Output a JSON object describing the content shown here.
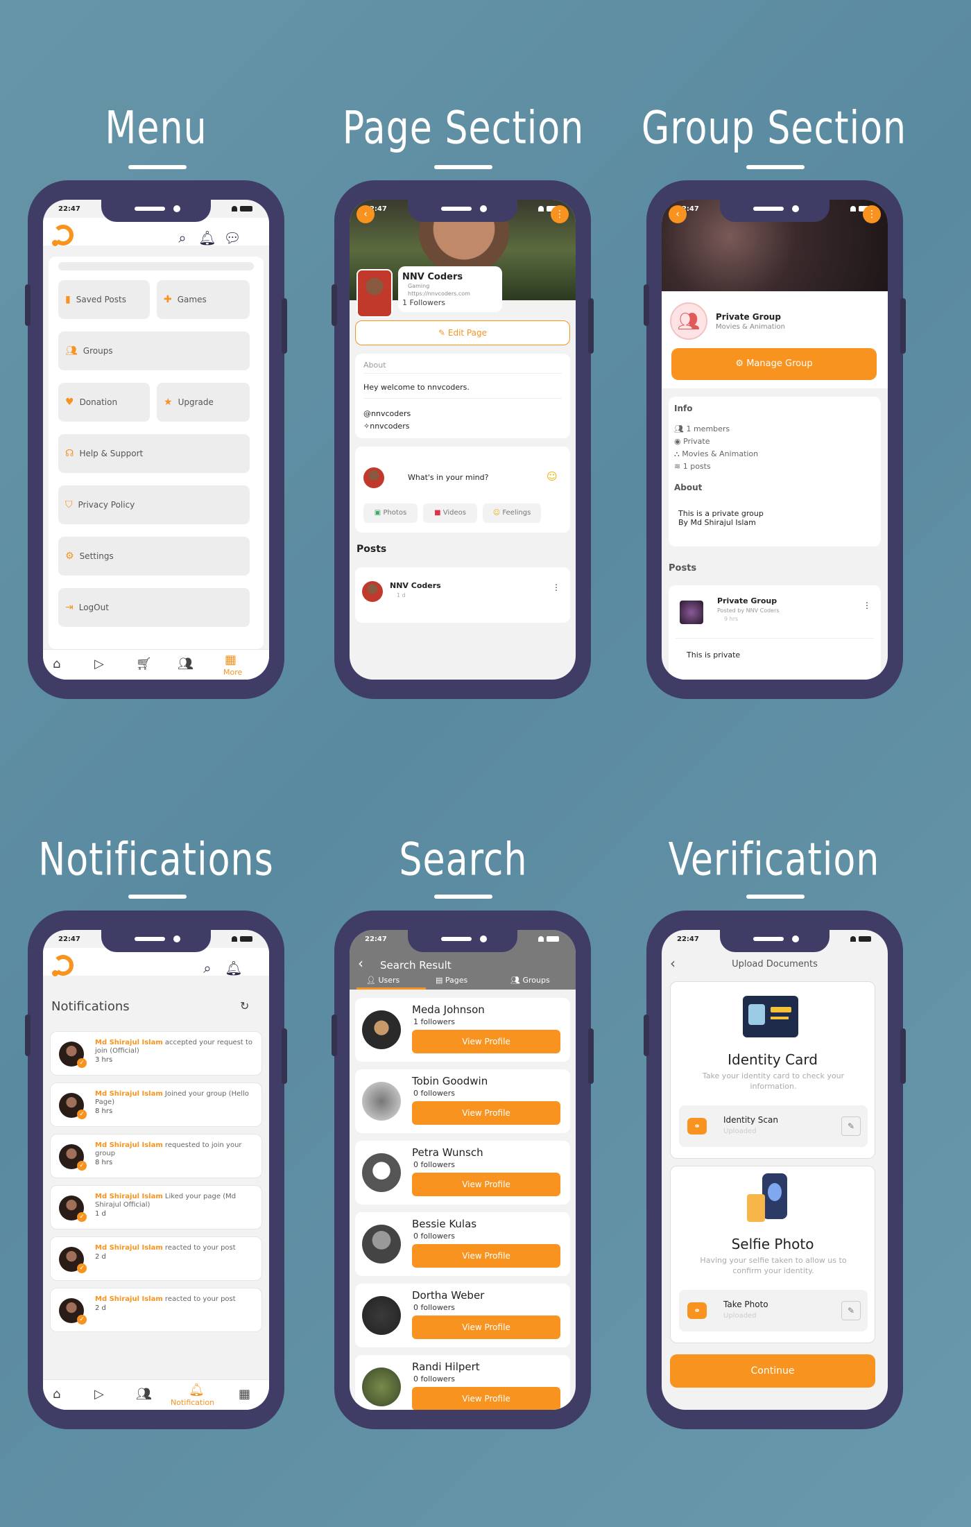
{
  "sections": {
    "menu": "Menu",
    "page": "Page Section",
    "group": "Group Section",
    "notifications": "Notifications",
    "search": "Search",
    "verification": "Verification"
  },
  "status_time": "22:47",
  "menu": {
    "items": [
      "Saved Posts",
      "Games",
      "Groups",
      "Donation",
      "Upgrade",
      "Help & Support",
      "Privacy Policy",
      "Settings",
      "LogOut"
    ],
    "more_label": "More"
  },
  "page": {
    "name": "NNV Coders",
    "category": "Gaming",
    "url": "https://nnvcoders.com",
    "followers_count": "1",
    "followers_label": "Followers",
    "edit_label": "Edit Page",
    "about_label": "About",
    "about_text": "Hey welcome to nnvcoders.",
    "handle1": "@nnvcoders",
    "handle2": "nnvcoders",
    "compose_placeholder": "What's in your mind?",
    "compose_actions": [
      "Photos",
      "Videos",
      "Feelings"
    ],
    "posts_label": "Posts",
    "post_author": "NNV Coders",
    "post_time": "1 d"
  },
  "group": {
    "name": "Private Group",
    "category": "Movies & Animation",
    "manage_label": "Manage Group",
    "info_label": "Info",
    "info": [
      "1 members",
      "Private",
      "Movies & Animation",
      "1 posts"
    ],
    "about_label": "About",
    "about_text": "This is a private group\nBy Md Shirajul Islam",
    "posts_label": "Posts",
    "post_title": "Private Group",
    "post_by": "Posted by NNV Coders",
    "post_time": "9 hrs",
    "post_text": "This is private"
  },
  "notifications": {
    "title": "Notifications",
    "items": [
      {
        "name": "Md Shirajul Islam",
        "text": " accepted your request to join (Official)",
        "time": "3 hrs"
      },
      {
        "name": "Md Shirajul Islam",
        "text": " Joined your group (Hello Page)",
        "time": "8 hrs"
      },
      {
        "name": "Md Shirajul Islam",
        "text": " requested to join your group",
        "time": "8 hrs"
      },
      {
        "name": "Md Shirajul Islam",
        "text": " Liked your page (Md Shirajul Official)",
        "time": "1 d"
      },
      {
        "name": "Md Shirajul Islam",
        "text": " reacted to your post",
        "time": "2 d"
      },
      {
        "name": "Md Shirajul Islam",
        "text": " reacted to your post",
        "time": "2 d"
      }
    ],
    "nav_label": "Notification"
  },
  "search": {
    "title": "Search Result",
    "tabs": [
      "Users",
      "Pages",
      "Groups"
    ],
    "view_label": "View Profile",
    "users": [
      {
        "name": "Meda Johnson",
        "followers": "1 followers"
      },
      {
        "name": "Tobin Goodwin",
        "followers": "0 followers"
      },
      {
        "name": "Petra Wunsch",
        "followers": "0 followers"
      },
      {
        "name": "Bessie Kulas",
        "followers": "0 followers"
      },
      {
        "name": "Dortha Weber",
        "followers": "0 followers"
      },
      {
        "name": "Randi Hilpert",
        "followers": "0 followers"
      }
    ]
  },
  "verification": {
    "title": "Upload Documents",
    "id_title": "Identity Card",
    "id_desc": "Take your identity card to check your information.",
    "id_scan": "Identity Scan",
    "id_status": "Uploaded",
    "selfie_title": "Selfie Photo",
    "selfie_desc": "Having your selfie taken to allow us to confirm your identity.",
    "selfie_action": "Take Photo",
    "selfie_status": "Uploaded",
    "continue_label": "Continue"
  },
  "colors": {
    "accent": "#f7931e",
    "frame": "#3f3d65",
    "background": "#6795a8"
  }
}
